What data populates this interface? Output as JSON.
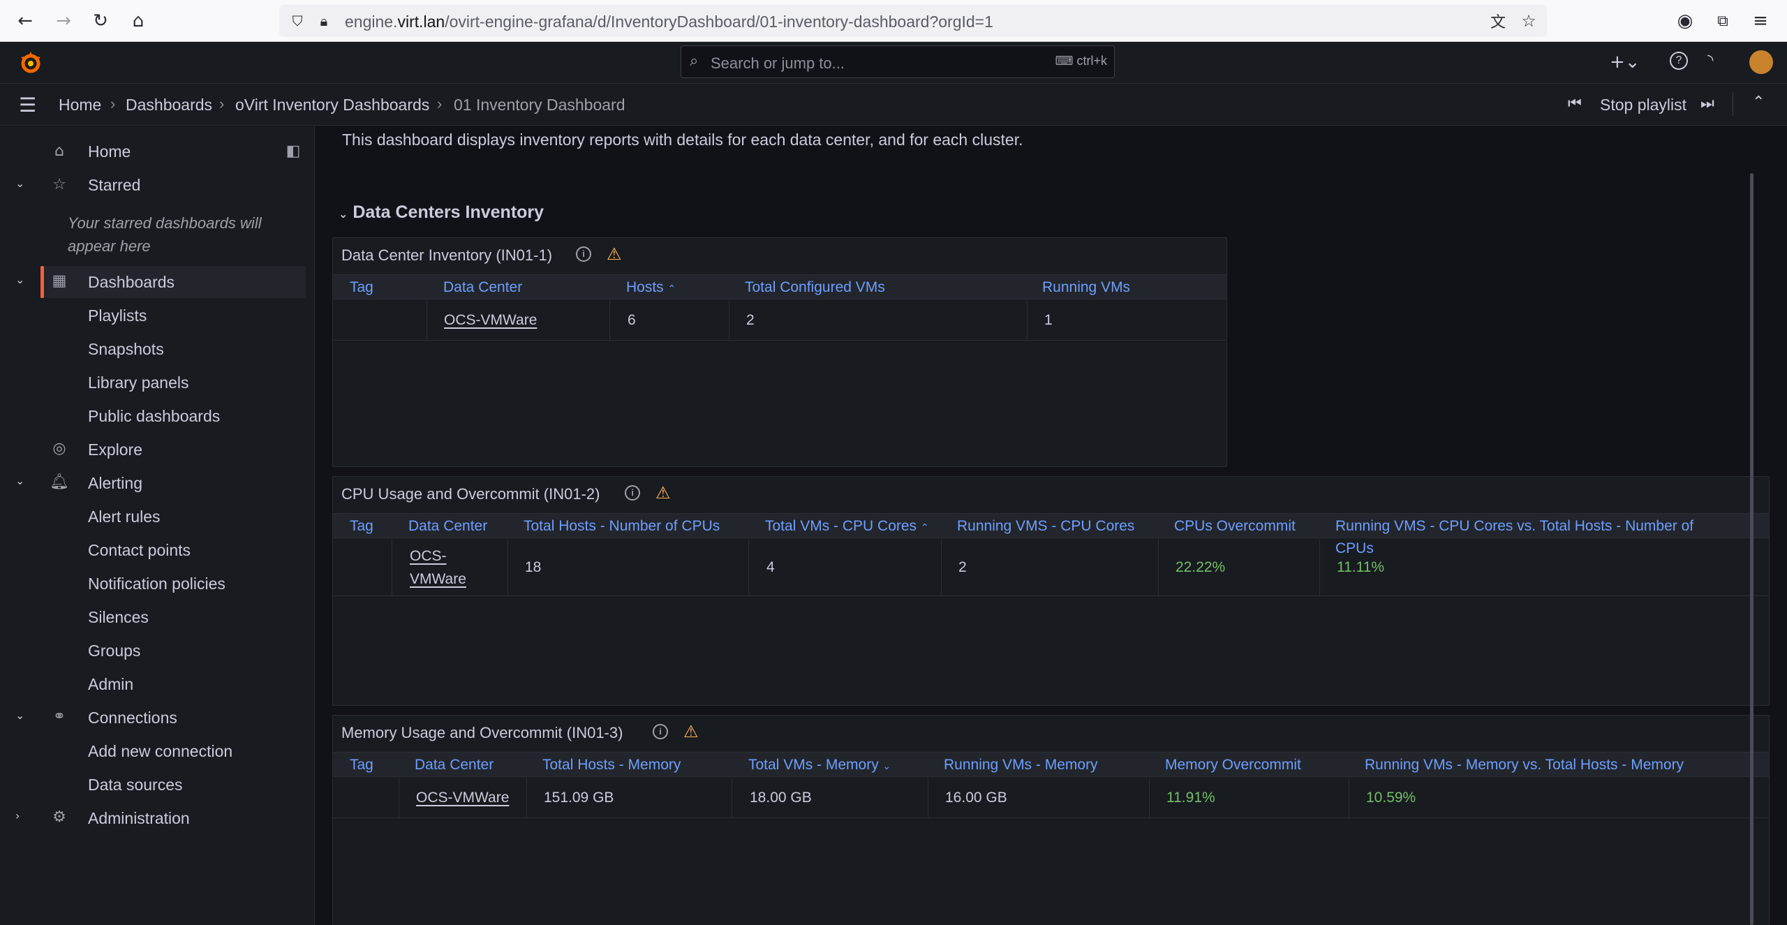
{
  "browser": {
    "url_prefix": "engine.",
    "url_domain": "virt.lan",
    "url_rest": "/ovirt-engine-grafana/d/InventoryDashboard/01-inventory-dashboard?orgId=1"
  },
  "topbar": {
    "search_placeholder": "Search or jump to...",
    "shortcut": "ctrl+k"
  },
  "breadcrumb": {
    "items": [
      "Home",
      "Dashboards",
      "oVirt Inventory Dashboards",
      "01 Inventory Dashboard"
    ],
    "stop_playlist": "Stop playlist"
  },
  "sidebar": {
    "home": "Home",
    "starred": "Starred",
    "starred_empty": "Your starred dashboards will appear here",
    "dashboards": "Dashboards",
    "dashboards_children": [
      "Playlists",
      "Snapshots",
      "Library panels",
      "Public dashboards"
    ],
    "explore": "Explore",
    "alerting": "Alerting",
    "alerting_children": [
      "Alert rules",
      "Contact points",
      "Notification policies",
      "Silences",
      "Groups",
      "Admin"
    ],
    "connections": "Connections",
    "connections_children": [
      "Add new connection",
      "Data sources"
    ],
    "administration": "Administration"
  },
  "main": {
    "description": "This dashboard displays inventory reports with details for each data center, and for each cluster.",
    "row_title": "Data Centers Inventory",
    "panel1": {
      "title": "Data Center Inventory (IN01-1)",
      "headers": [
        "Tag",
        "Data Center",
        "Hosts",
        "Total Configured VMs",
        "Running VMs"
      ],
      "row": [
        "",
        "OCS-VMWare",
        "6",
        "2",
        "1"
      ]
    },
    "panel2": {
      "title": "CPU Usage and Overcommit (IN01-2)",
      "headers": [
        "Tag",
        "Data Center",
        "Total Hosts - Number of CPUs",
        "Total VMs - CPU Cores",
        "Running VMS - CPU Cores",
        "CPUs Overcommit",
        "Running VMS - CPU Cores vs. Total Hosts - Number of",
        "CPUs"
      ],
      "row": [
        "",
        "OCS-",
        "VMWare",
        "18",
        "4",
        "2",
        "22.22%",
        "11.11%"
      ]
    },
    "panel3": {
      "title": "Memory Usage and Overcommit (IN01-3)",
      "headers": [
        "Tag",
        "Data Center",
        "Total Hosts - Memory",
        "Total VMs - Memory",
        "Running VMs - Memory",
        "Memory Overcommit",
        "Running VMs - Memory vs. Total Hosts - Memory"
      ],
      "row": [
        "",
        "OCS-VMWare",
        "151.09 GB",
        "18.00 GB",
        "16.00 GB",
        "11.91%",
        "10.59%"
      ]
    }
  },
  "colors": {
    "accent": "#f55f3e",
    "link": "#6e9fff",
    "ok": "#73bf69",
    "warning": "#ffb357"
  }
}
